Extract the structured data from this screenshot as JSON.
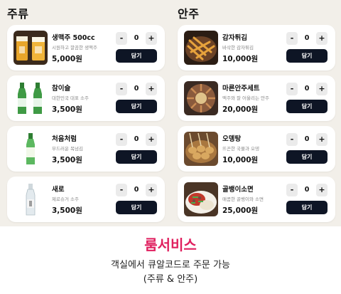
{
  "sections": {
    "drinks_title": "주류",
    "snacks_title": "안주"
  },
  "drinks": [
    {
      "name": "생맥주 500cc",
      "desc": "시원하고 깔끔한 생맥주",
      "price": "5,000원",
      "qty": "0",
      "minus": "-",
      "plus": "+",
      "cart": "담기",
      "icon": "beer-glass-icon"
    },
    {
      "name": "참이슬",
      "desc": "대한민국 대표 소주",
      "price": "3,500원",
      "qty": "0",
      "minus": "-",
      "plus": "+",
      "cart": "담기",
      "icon": "soju-bottle-icon"
    },
    {
      "name": "처음처럼",
      "desc": "부드러운 목넘김",
      "price": "3,500원",
      "qty": "0",
      "minus": "-",
      "plus": "+",
      "cart": "담기",
      "icon": "soju-bottle-icon"
    },
    {
      "name": "새로",
      "desc": "제로슈거 소주",
      "price": "3,500원",
      "qty": "0",
      "minus": "-",
      "plus": "+",
      "cart": "담기",
      "icon": "clear-bottle-icon"
    }
  ],
  "snacks": [
    {
      "name": "감자튀김",
      "desc": "바삭한 감자튀김",
      "price": "10,000원",
      "qty": "0",
      "minus": "-",
      "plus": "+",
      "cart": "담기",
      "icon": "fries-icon"
    },
    {
      "name": "마른안주세트",
      "desc": "맥주와 잘 어울리는 안주",
      "price": "20,000원",
      "qty": "0",
      "minus": "-",
      "plus": "+",
      "cart": "담기",
      "icon": "dry-snack-icon"
    },
    {
      "name": "오뎅탕",
      "desc": "뜨끈한 국물과 오뎅",
      "price": "10,000원",
      "qty": "0",
      "minus": "-",
      "plus": "+",
      "cart": "담기",
      "icon": "fishcake-soup-icon"
    },
    {
      "name": "골뱅이소면",
      "desc": "매콤한 골뱅이와 소면",
      "price": "25,000원",
      "qty": "0",
      "minus": "-",
      "plus": "+",
      "cart": "담기",
      "icon": "noodle-dish-icon"
    }
  ],
  "footer": {
    "title": "룸서비스",
    "line1": "객실에서 큐알코드로 주문 가능",
    "line2": "(주류 & 안주)"
  },
  "colors": {
    "panel_bg": "#f2efe9",
    "button_dark": "#0e1525",
    "accent": "#e0205f"
  }
}
